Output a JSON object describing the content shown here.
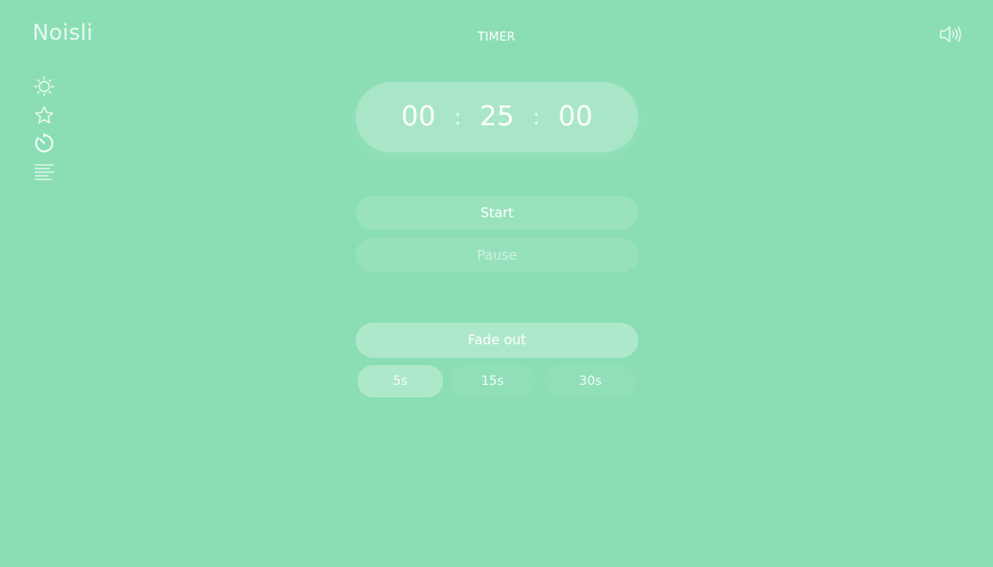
{
  "app": {
    "logo": "Noisli",
    "page_title": "TIMER"
  },
  "header": {
    "volume_icon": "speaker-icon"
  },
  "sidebar": {
    "items": [
      {
        "icon": "sun-icon",
        "active": false
      },
      {
        "icon": "star-icon",
        "active": false
      },
      {
        "icon": "timer-icon",
        "active": true
      },
      {
        "icon": "text-lines-icon",
        "active": false
      }
    ]
  },
  "timer": {
    "hours": "00",
    "minutes": "25",
    "seconds": "00",
    "separator": ":"
  },
  "controls": {
    "start_label": "Start",
    "pause_label": "Pause"
  },
  "fade_out": {
    "label": "Fade out",
    "options": [
      "5s",
      "15s",
      "30s"
    ],
    "selected": "5s"
  },
  "colors": {
    "background": "#8bdeb4",
    "text": "#ffffff"
  }
}
